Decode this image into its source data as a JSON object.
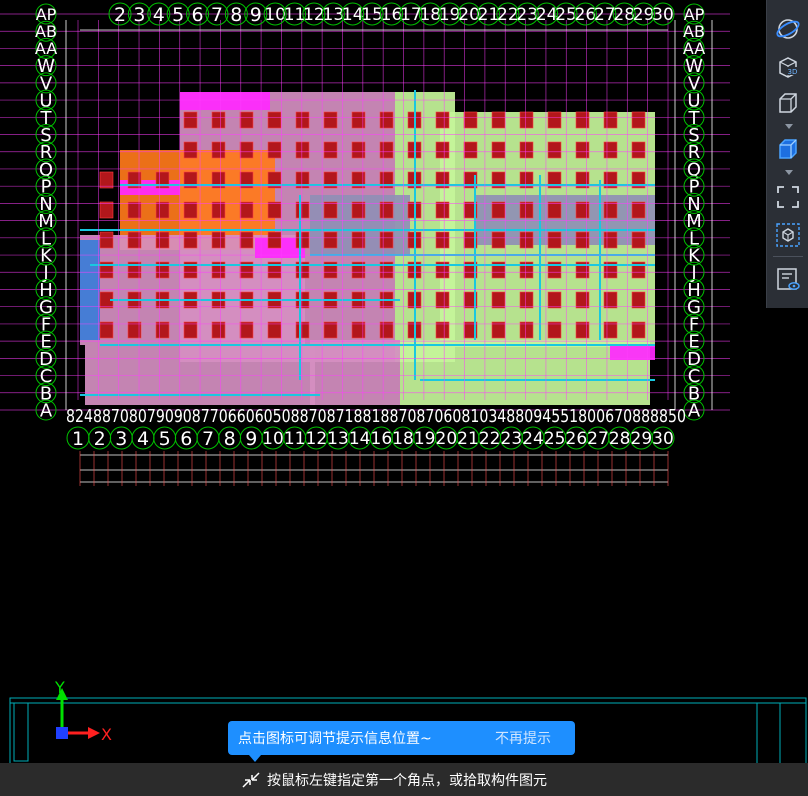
{
  "drawing": {
    "grid_top_labels": [
      "2",
      "3",
      "4",
      "5",
      "6",
      "7",
      "8",
      "9",
      "10",
      "11",
      "12",
      "13",
      "14",
      "15",
      "16",
      "17",
      "18",
      "19",
      "20",
      "21",
      "22",
      "23",
      "24",
      "25",
      "26",
      "27",
      "28",
      "29",
      "30"
    ],
    "grid_bottom_labels": [
      "1",
      "2",
      "3",
      "4",
      "5",
      "6",
      "7",
      "8",
      "9",
      "10",
      "11",
      "12",
      "13",
      "14",
      "16",
      "18",
      "19",
      "20",
      "21",
      "22",
      "23",
      "24",
      "25",
      "26",
      "27",
      "28",
      "29",
      "30"
    ],
    "grid_left_labels": [
      "AP",
      "AB",
      "AA",
      "W",
      "V",
      "U",
      "T",
      "S",
      "R",
      "Q",
      "P",
      "N",
      "M",
      "L",
      "K",
      "J",
      "H",
      "G",
      "F",
      "E",
      "D",
      "C",
      "B",
      "A"
    ],
    "grid_right_labels": [
      "AP",
      "AB",
      "AA",
      "W",
      "V",
      "U",
      "T",
      "S",
      "R",
      "Q",
      "P",
      "N",
      "M",
      "L",
      "K",
      "J",
      "H",
      "G",
      "F",
      "E",
      "D",
      "C",
      "B",
      "A"
    ],
    "bottom_dimension_row": "824887080790908770660605088708718818870870608103488094551800670888850",
    "axis_x_label": "X",
    "axis_y_label": "Y"
  },
  "view_toolbar": {
    "buttons": [
      {
        "name": "orbit-icon"
      },
      {
        "name": "view-3d-icon",
        "label": "3D"
      },
      {
        "name": "box-view-icon"
      },
      {
        "name": "cube-view-icon"
      },
      {
        "name": "fit-view-icon"
      },
      {
        "name": "component-view-icon"
      },
      {
        "name": "display-settings-icon"
      }
    ]
  },
  "tip": {
    "message": "点击图标可调节提示信息位置~",
    "dismiss": "不再提示"
  },
  "status": {
    "prompt": "按鼠标左键指定第一个角点，或拾取构件图元"
  },
  "colors": {
    "background": "#000000",
    "grid_line": "#ff3cff",
    "bubble_circle": "#00c000",
    "tip_blue": "#1e8fff",
    "green_zone": "#c6f59a",
    "pink_zone": "#d58fc1",
    "orange_zone": "#ff7a1a",
    "cyan_line": "#19c8e0",
    "column_red": "#b2171b"
  }
}
